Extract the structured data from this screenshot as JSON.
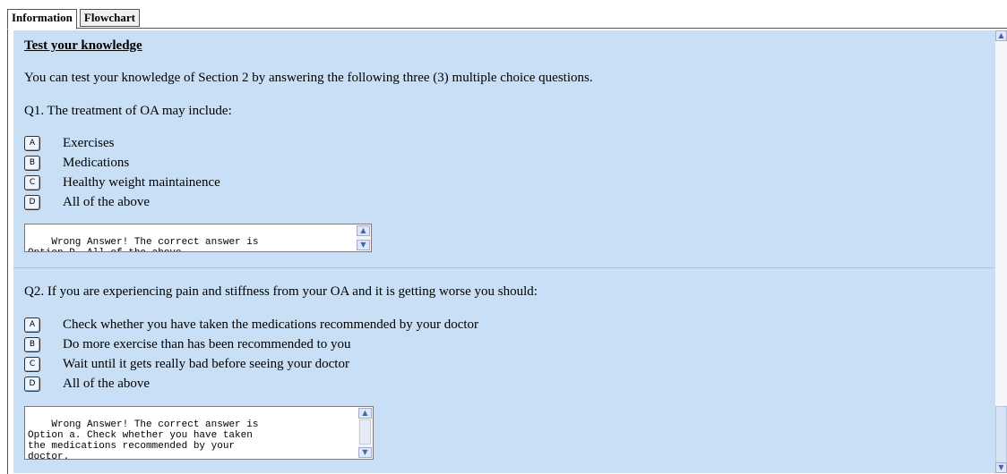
{
  "tabs": [
    {
      "label": "Information"
    },
    {
      "label": "Flowchart"
    }
  ],
  "heading": "Test your knowledge",
  "intro": "You can test your knowledge of Section 2 by answering the following three (3) multiple choice questions.",
  "questions": [
    {
      "text": "Q1. The treatment of OA may include:",
      "options": [
        {
          "key": "A",
          "text": "Exercises"
        },
        {
          "key": "B",
          "text": "Medications"
        },
        {
          "key": "C",
          "text": "Healthy weight maintainence"
        },
        {
          "key": "D",
          "text": "All of the above"
        }
      ],
      "feedback": "Wrong Answer! The correct answer is\nOption D. All of the above."
    },
    {
      "text": "Q2. If you are experiencing pain and stiffness from your OA and it is getting worse you should:",
      "options": [
        {
          "key": "A",
          "text": "Check whether you have taken the medications recommended by your doctor"
        },
        {
          "key": "B",
          "text": "Do more exercise than has been recommended to you"
        },
        {
          "key": "C",
          "text": "Wait until it gets really bad before seeing your doctor"
        },
        {
          "key": "D",
          "text": "All of the above"
        }
      ],
      "feedback": "Wrong Answer! The correct answer is\nOption a. Check whether you have taken\nthe medications recommended by your\ndoctor."
    }
  ]
}
